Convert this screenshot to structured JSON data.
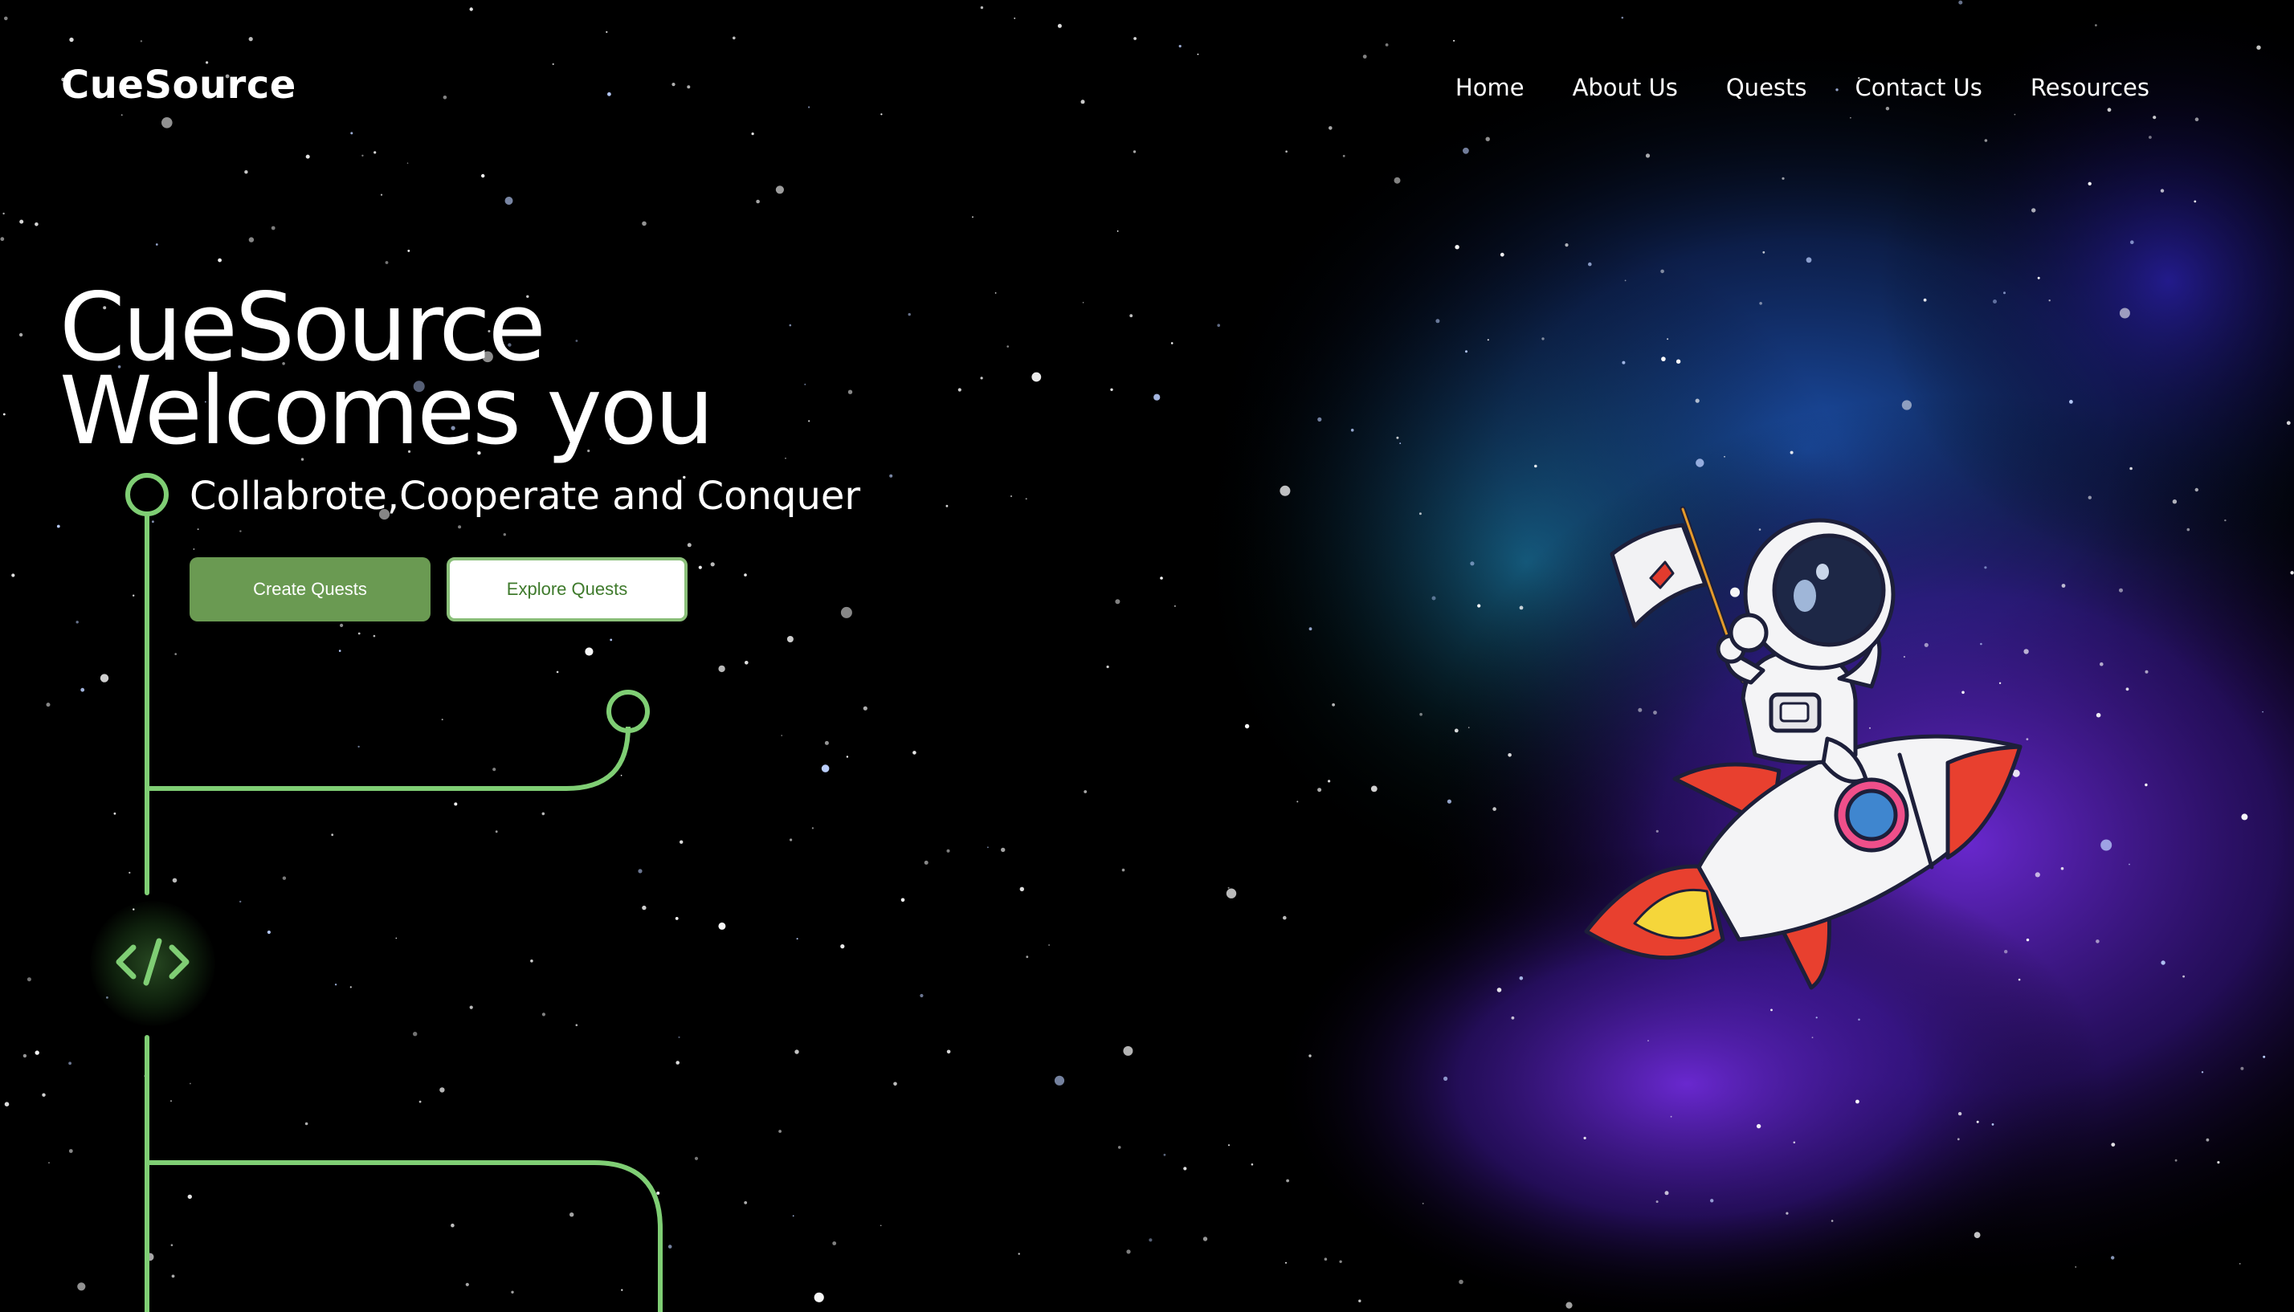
{
  "brand": {
    "logo_text": "CueSource"
  },
  "nav": {
    "items": [
      {
        "label": "Home"
      },
      {
        "label": "About Us"
      },
      {
        "label": "Quests"
      },
      {
        "label": "Contact Us"
      },
      {
        "label": "Resources"
      }
    ]
  },
  "hero": {
    "title_line1": "CueSource",
    "title_line2": "Welcomes you",
    "tagline": "Collabrote,Cooperate and Conquer",
    "create_button": "Create Quests",
    "explore_button": "Explore Quests"
  },
  "badge": {
    "code_glyph": "</>",
    "icon": "code-icon"
  },
  "illustration": {
    "icon": "astronaut-on-rocket"
  },
  "colors": {
    "background": "#000000",
    "circuit_green": "#7fce74",
    "primary_button": "#6a9a52",
    "secondary_button_text": "#3f7a2c",
    "nebula_blue": "#1f4fae",
    "nebula_purple": "#6a2ad0"
  }
}
